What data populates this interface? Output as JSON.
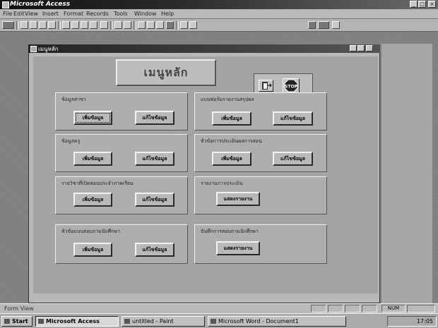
{
  "window": {
    "title": "Microsoft Access",
    "controls": [
      "_",
      "□",
      "×"
    ]
  },
  "menu": [
    "File",
    "Edit",
    "View",
    "Insert",
    "Format",
    "Records",
    "Tools",
    "Window",
    "Help"
  ],
  "form": {
    "title": "เมนูหลัก",
    "main_label": "เมนูหลัก",
    "stop_label": "STOP",
    "sections": [
      {
        "label": "ข้อมูลสาขา",
        "buttons": [
          "เพิ่มข้อมูล",
          "แก้ไขข้อมูล"
        ]
      },
      {
        "label": "แบบฟอร์มรายงานสรุปผล",
        "buttons": [
          "เพิ่มข้อมูล",
          "แก้ไขข้อมูล"
        ]
      },
      {
        "label": "ข้อมูลครู",
        "buttons": [
          "เพิ่มข้อมูล",
          "แก้ไขข้อมูล"
        ]
      },
      {
        "label": "หัวข้อการประเมินผลการสอน",
        "buttons": [
          "เพิ่มข้อมูล",
          "แก้ไขข้อมูล"
        ]
      },
      {
        "label": "รายวิชาที่เปิดสอนประจำภาคเรียน",
        "buttons": [
          "เพิ่มข้อมูล",
          "แก้ไขข้อมูล"
        ]
      },
      {
        "label": "รายงานการประเมิน",
        "buttons": [
          "แสดงรายงาน"
        ]
      },
      {
        "label": "หัวข้อแบบสอบถามนักศึกษา",
        "buttons": [
          "เพิ่มข้อมูล",
          "แก้ไขข้อมูล"
        ]
      },
      {
        "label": "บันทึกการสอบถามนักศึกษา",
        "buttons": [
          "แสดงรายงาน"
        ]
      }
    ]
  },
  "status": {
    "left": "Form View",
    "num": "NUM"
  },
  "taskbar": {
    "start": "Start",
    "tasks": [
      "Microsoft Access",
      "untitled - Paint",
      "Microsoft Word - Document1"
    ],
    "clock": "17:05"
  }
}
